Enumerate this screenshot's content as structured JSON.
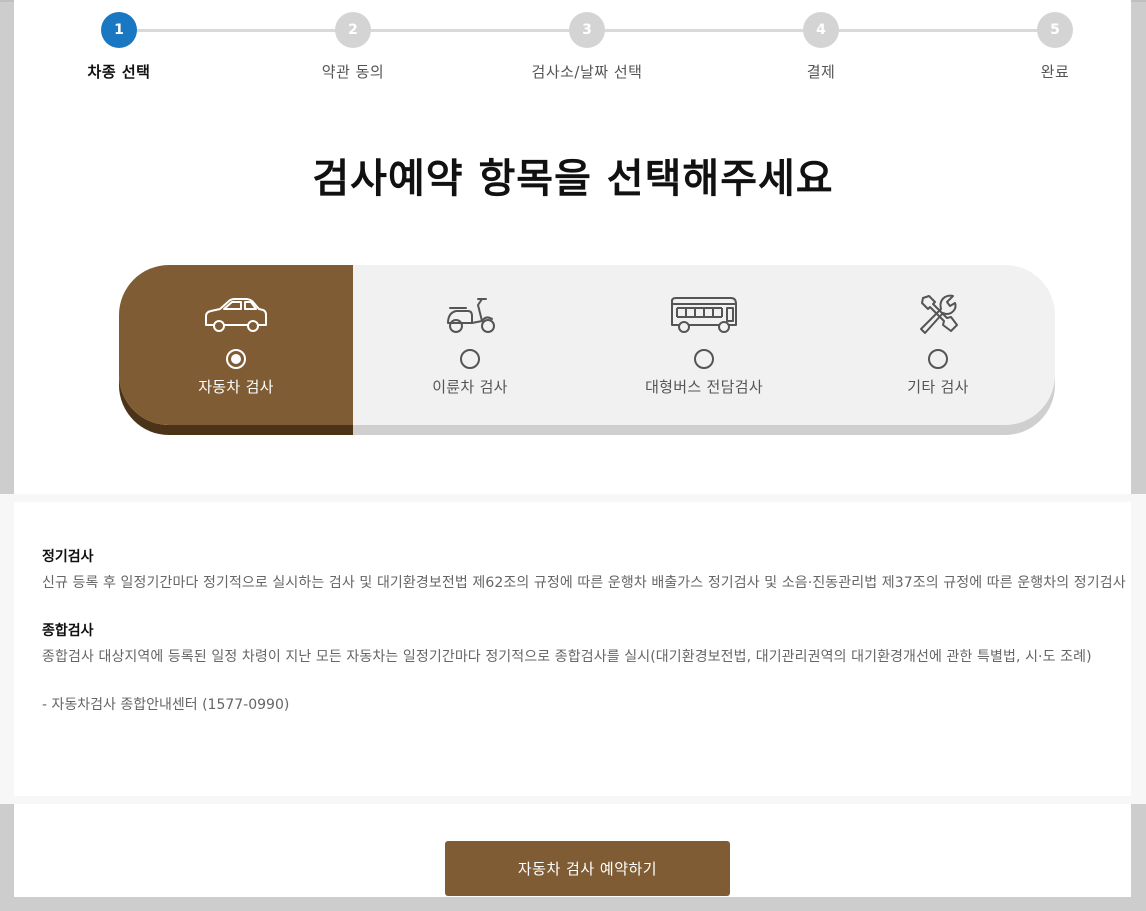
{
  "stepper": {
    "steps": [
      {
        "number": "1",
        "label": "차종 선택"
      },
      {
        "number": "2",
        "label": "약관 동의"
      },
      {
        "number": "3",
        "label": "검사소/날짜 선택"
      },
      {
        "number": "4",
        "label": "결제"
      },
      {
        "number": "5",
        "label": "완료"
      }
    ],
    "active_step": 1
  },
  "title": "검사예약 항목을 선택해주세요",
  "selector": {
    "options": [
      {
        "label": "자동차 검사",
        "icon": "car-icon",
        "selected": true
      },
      {
        "label": "이륜차 검사",
        "icon": "scooter-icon",
        "selected": false
      },
      {
        "label": "대형버스 전담검사",
        "icon": "bus-icon",
        "selected": false
      },
      {
        "label": "기타 검사",
        "icon": "tools-icon",
        "selected": false
      }
    ]
  },
  "info": {
    "regular": {
      "title": "정기검사",
      "text": "신규 등록 후 일정기간마다 정기적으로 실시하는 검사 및 대기환경보전법 제62조의 규정에 따른 운행차 배출가스 정기검사 및 소음·진동관리법 제37조의 규정에 따른 운행차의 정기검사"
    },
    "comprehensive": {
      "title": "종합검사",
      "text": "종합검사 대상지역에 등록된 일정 차령이 지난 모든 자동차는 일정기간마다 정기적으로 종합검사를 실시(대기환경보전법, 대기관리권역의 대기환경개선에 관한 특별법, 시·도 조례)"
    },
    "contact": "- 자동차검사 종합안내센터 (1577-0990)"
  },
  "button": {
    "label": "자동차 검사 예약하기"
  },
  "colors": {
    "accent_brown": "#7f5c33",
    "active_blue": "#1a78c2",
    "inactive_gray": "#d4d4d4"
  }
}
